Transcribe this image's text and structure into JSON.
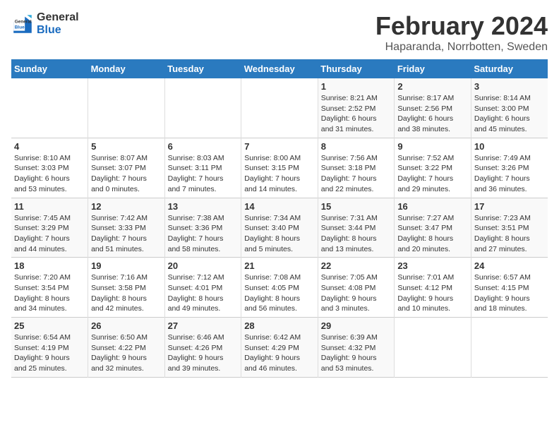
{
  "header": {
    "logo_line1": "General",
    "logo_line2": "Blue",
    "title": "February 2024",
    "subtitle": "Haparanda, Norrbotten, Sweden"
  },
  "weekdays": [
    "Sunday",
    "Monday",
    "Tuesday",
    "Wednesday",
    "Thursday",
    "Friday",
    "Saturday"
  ],
  "weeks": [
    [
      {
        "day": "",
        "info": ""
      },
      {
        "day": "",
        "info": ""
      },
      {
        "day": "",
        "info": ""
      },
      {
        "day": "",
        "info": ""
      },
      {
        "day": "1",
        "info": "Sunrise: 8:21 AM\nSunset: 2:52 PM\nDaylight: 6 hours\nand 31 minutes."
      },
      {
        "day": "2",
        "info": "Sunrise: 8:17 AM\nSunset: 2:56 PM\nDaylight: 6 hours\nand 38 minutes."
      },
      {
        "day": "3",
        "info": "Sunrise: 8:14 AM\nSunset: 3:00 PM\nDaylight: 6 hours\nand 45 minutes."
      }
    ],
    [
      {
        "day": "4",
        "info": "Sunrise: 8:10 AM\nSunset: 3:03 PM\nDaylight: 6 hours\nand 53 minutes."
      },
      {
        "day": "5",
        "info": "Sunrise: 8:07 AM\nSunset: 3:07 PM\nDaylight: 7 hours\nand 0 minutes."
      },
      {
        "day": "6",
        "info": "Sunrise: 8:03 AM\nSunset: 3:11 PM\nDaylight: 7 hours\nand 7 minutes."
      },
      {
        "day": "7",
        "info": "Sunrise: 8:00 AM\nSunset: 3:15 PM\nDaylight: 7 hours\nand 14 minutes."
      },
      {
        "day": "8",
        "info": "Sunrise: 7:56 AM\nSunset: 3:18 PM\nDaylight: 7 hours\nand 22 minutes."
      },
      {
        "day": "9",
        "info": "Sunrise: 7:52 AM\nSunset: 3:22 PM\nDaylight: 7 hours\nand 29 minutes."
      },
      {
        "day": "10",
        "info": "Sunrise: 7:49 AM\nSunset: 3:26 PM\nDaylight: 7 hours\nand 36 minutes."
      }
    ],
    [
      {
        "day": "11",
        "info": "Sunrise: 7:45 AM\nSunset: 3:29 PM\nDaylight: 7 hours\nand 44 minutes."
      },
      {
        "day": "12",
        "info": "Sunrise: 7:42 AM\nSunset: 3:33 PM\nDaylight: 7 hours\nand 51 minutes."
      },
      {
        "day": "13",
        "info": "Sunrise: 7:38 AM\nSunset: 3:36 PM\nDaylight: 7 hours\nand 58 minutes."
      },
      {
        "day": "14",
        "info": "Sunrise: 7:34 AM\nSunset: 3:40 PM\nDaylight: 8 hours\nand 5 minutes."
      },
      {
        "day": "15",
        "info": "Sunrise: 7:31 AM\nSunset: 3:44 PM\nDaylight: 8 hours\nand 13 minutes."
      },
      {
        "day": "16",
        "info": "Sunrise: 7:27 AM\nSunset: 3:47 PM\nDaylight: 8 hours\nand 20 minutes."
      },
      {
        "day": "17",
        "info": "Sunrise: 7:23 AM\nSunset: 3:51 PM\nDaylight: 8 hours\nand 27 minutes."
      }
    ],
    [
      {
        "day": "18",
        "info": "Sunrise: 7:20 AM\nSunset: 3:54 PM\nDaylight: 8 hours\nand 34 minutes."
      },
      {
        "day": "19",
        "info": "Sunrise: 7:16 AM\nSunset: 3:58 PM\nDaylight: 8 hours\nand 42 minutes."
      },
      {
        "day": "20",
        "info": "Sunrise: 7:12 AM\nSunset: 4:01 PM\nDaylight: 8 hours\nand 49 minutes."
      },
      {
        "day": "21",
        "info": "Sunrise: 7:08 AM\nSunset: 4:05 PM\nDaylight: 8 hours\nand 56 minutes."
      },
      {
        "day": "22",
        "info": "Sunrise: 7:05 AM\nSunset: 4:08 PM\nDaylight: 9 hours\nand 3 minutes."
      },
      {
        "day": "23",
        "info": "Sunrise: 7:01 AM\nSunset: 4:12 PM\nDaylight: 9 hours\nand 10 minutes."
      },
      {
        "day": "24",
        "info": "Sunrise: 6:57 AM\nSunset: 4:15 PM\nDaylight: 9 hours\nand 18 minutes."
      }
    ],
    [
      {
        "day": "25",
        "info": "Sunrise: 6:54 AM\nSunset: 4:19 PM\nDaylight: 9 hours\nand 25 minutes."
      },
      {
        "day": "26",
        "info": "Sunrise: 6:50 AM\nSunset: 4:22 PM\nDaylight: 9 hours\nand 32 minutes."
      },
      {
        "day": "27",
        "info": "Sunrise: 6:46 AM\nSunset: 4:26 PM\nDaylight: 9 hours\nand 39 minutes."
      },
      {
        "day": "28",
        "info": "Sunrise: 6:42 AM\nSunset: 4:29 PM\nDaylight: 9 hours\nand 46 minutes."
      },
      {
        "day": "29",
        "info": "Sunrise: 6:39 AM\nSunset: 4:32 PM\nDaylight: 9 hours\nand 53 minutes."
      },
      {
        "day": "",
        "info": ""
      },
      {
        "day": "",
        "info": ""
      }
    ]
  ]
}
